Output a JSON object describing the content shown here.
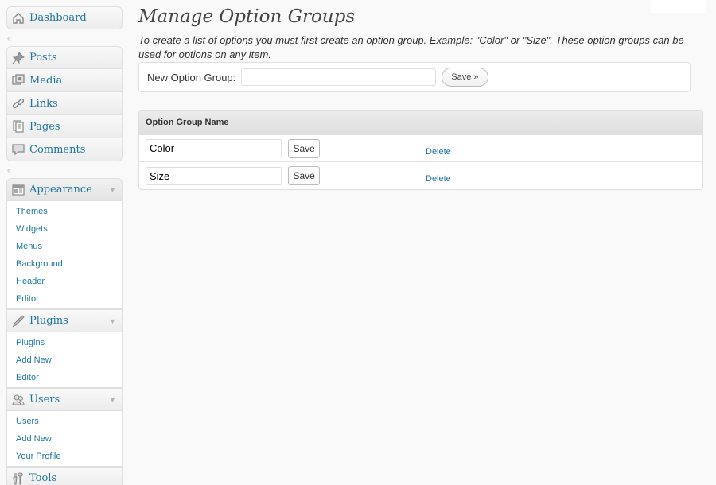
{
  "sidebar": {
    "dashboard": {
      "label": "Dashboard",
      "icon": "dashboard-icon"
    },
    "group1": [
      {
        "label": "Posts",
        "icon": "pushpin-icon"
      },
      {
        "label": "Media",
        "icon": "media-icon"
      },
      {
        "label": "Links",
        "icon": "link-icon"
      },
      {
        "label": "Pages",
        "icon": "pages-icon"
      },
      {
        "label": "Comments",
        "icon": "comments-icon"
      }
    ],
    "appearance": {
      "label": "Appearance",
      "icon": "appearance-icon",
      "items": [
        "Themes",
        "Widgets",
        "Menus",
        "Background",
        "Header",
        "Editor"
      ]
    },
    "plugins": {
      "label": "Plugins",
      "icon": "plugins-icon",
      "items": [
        "Plugins",
        "Add New",
        "Editor"
      ]
    },
    "users": {
      "label": "Users",
      "icon": "users-icon",
      "items": [
        "Users",
        "Add New",
        "Your Profile"
      ]
    },
    "tools": {
      "label": "Tools",
      "icon": "tools-icon"
    }
  },
  "main": {
    "title": "Manage Option Groups",
    "intro": "To create a list of options you must first create an option group. Example: \"Color\" or \"Size\". These option groups can be used for options on any item.",
    "new_group": {
      "label": "New Option Group:",
      "value": "",
      "save_label": "Save »"
    },
    "table": {
      "header": "Option Group Name",
      "rows": [
        {
          "name": "Color",
          "save_label": "Save",
          "delete_label": "Delete"
        },
        {
          "name": "Size",
          "save_label": "Save",
          "delete_label": "Delete"
        }
      ]
    }
  },
  "colors": {
    "link": "#21759b",
    "background": "#f9f9f9"
  }
}
